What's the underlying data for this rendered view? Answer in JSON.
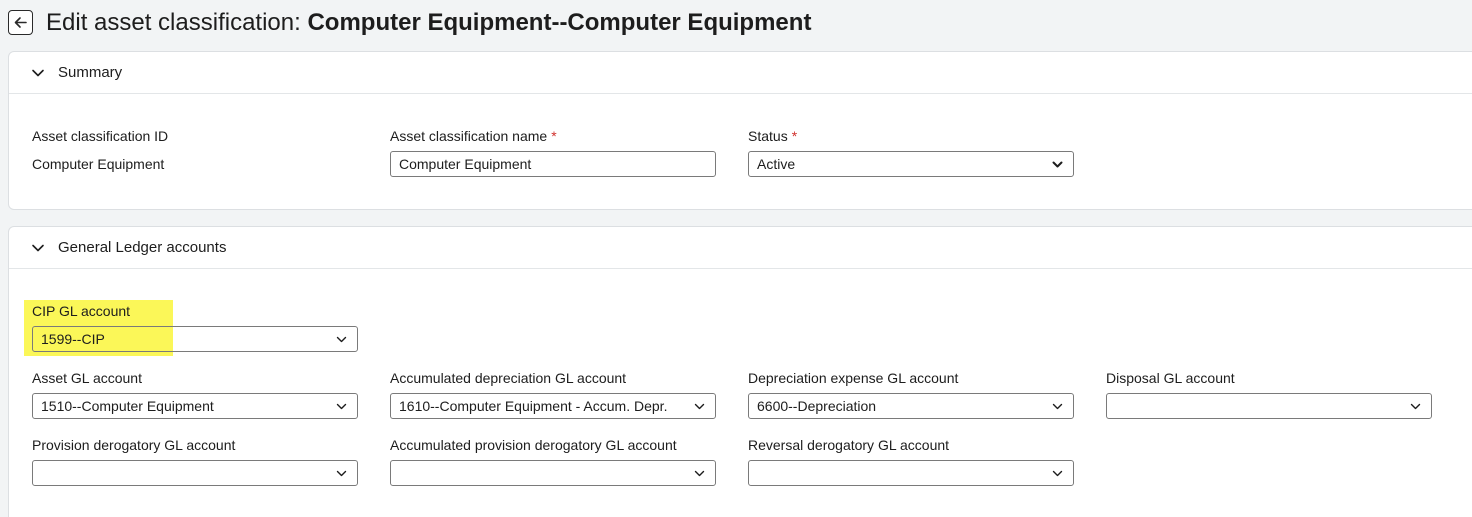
{
  "page": {
    "title_prefix": "Edit asset classification: ",
    "title_name": "Computer Equipment--Computer Equipment"
  },
  "icons": {
    "back": "arrow-left-icon",
    "collapse": "chevron-down-icon",
    "dropdown": "chevron-down-icon"
  },
  "colors": {
    "required": "#d0312d",
    "highlight": "#fbf758"
  },
  "summary": {
    "title": "Summary",
    "id_label": "Asset classification ID",
    "id_value": "Computer Equipment",
    "name_label": "Asset classification name",
    "name_value": "Computer Equipment",
    "status_label": "Status",
    "status_value": "Active",
    "required_mark": "*"
  },
  "gl": {
    "title": "General Ledger accounts",
    "cip_label": "CIP GL account",
    "cip_value": "1599--CIP",
    "asset_label": "Asset GL account",
    "asset_value": "1510--Computer Equipment",
    "accum_dep_label": "Accumulated depreciation GL account",
    "accum_dep_value": "1610--Computer Equipment - Accum. Depr.",
    "dep_exp_label": "Depreciation expense GL account",
    "dep_exp_value": "6600--Depreciation",
    "disposal_label": "Disposal GL account",
    "disposal_value": "",
    "prov_derog_label": "Provision derogatory GL account",
    "prov_derog_value": "",
    "accum_prov_derog_label": "Accumulated provision derogatory GL account",
    "accum_prov_derog_value": "",
    "reversal_derog_label": "Reversal derogatory GL account",
    "reversal_derog_value": ""
  }
}
